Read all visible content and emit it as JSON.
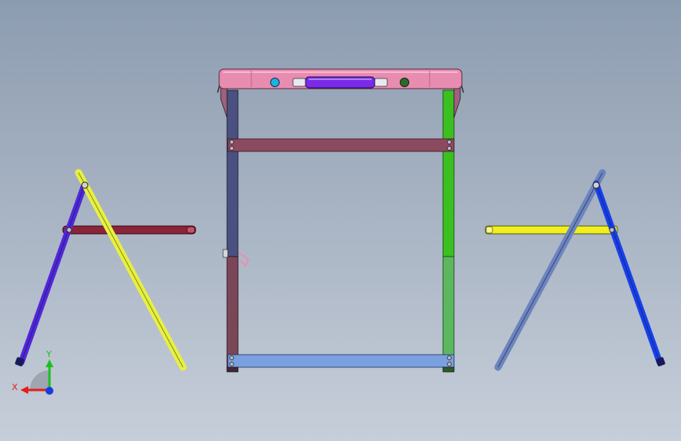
{
  "view": {
    "background_top": "#8c9cb0",
    "background_bottom": "#c6ced9"
  },
  "triad": {
    "x_label": "X",
    "y_label": "Y",
    "x_color": "#e0201a",
    "y_color": "#18c020",
    "z_color": "#1a3ae0"
  },
  "parts": {
    "tabletop_front": "#e88cb0",
    "tabletop_handle": "#7a2ae8",
    "tabletop_button_left": "#1ab4e0",
    "tabletop_button_right": "#2e6a2e",
    "frame_leg_left_upper": "#4a5080",
    "frame_leg_left_lower": "#7a4658",
    "frame_leg_right_upper": "#3cc020",
    "frame_leg_right_lower": "#5cb860",
    "frame_crossbar_top": "#8c4a60",
    "frame_crossbar_bottom": "#7aa0e0",
    "side_left_leg_blue": "#5028d8",
    "side_left_leg_yellow": "#e8f040",
    "side_left_top": "#8a2438",
    "side_right_leg_slate": "#6c84c0",
    "side_right_leg_blue": "#1840e8",
    "side_right_top": "#f0f020"
  }
}
